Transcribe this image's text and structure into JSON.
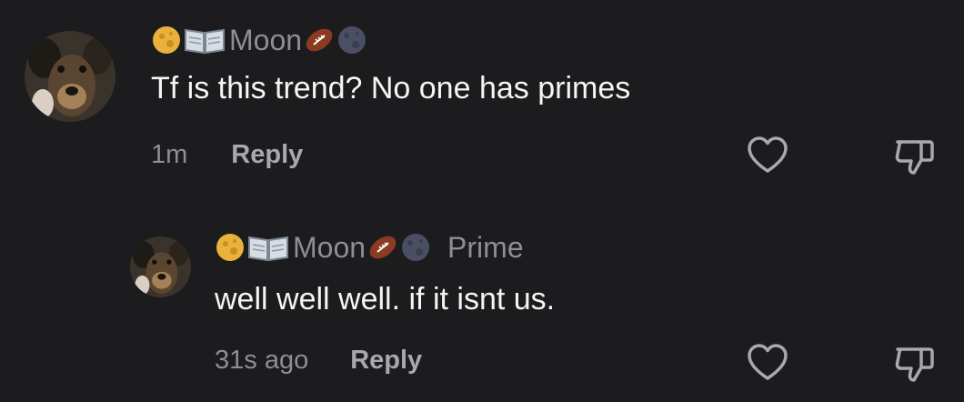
{
  "colors": {
    "background": "#1c1c1e",
    "primary_text": "#f5f5f5",
    "secondary_text": "#8e8e93",
    "reply_text": "#a8a8ad"
  },
  "comments": [
    {
      "username": "Moon",
      "name_emojis": [
        "full-moon-icon",
        "open-book-icon",
        "american-football-icon",
        "new-moon-icon"
      ],
      "text": "Tf is this trend? No one has primes",
      "timestamp": "1m",
      "reply_label": "Reply",
      "like_icon": "heart-icon",
      "dislike_icon": "thumbs-down-icon"
    },
    {
      "username": "Moon",
      "name_emojis": [
        "full-moon-icon",
        "open-book-icon",
        "american-football-icon",
        "new-moon-icon"
      ],
      "reply_to": "Prime",
      "text": "well well well. if it isnt us.",
      "timestamp": "31s ago",
      "reply_label": "Reply",
      "like_icon": "heart-icon",
      "dislike_icon": "thumbs-down-icon"
    }
  ]
}
